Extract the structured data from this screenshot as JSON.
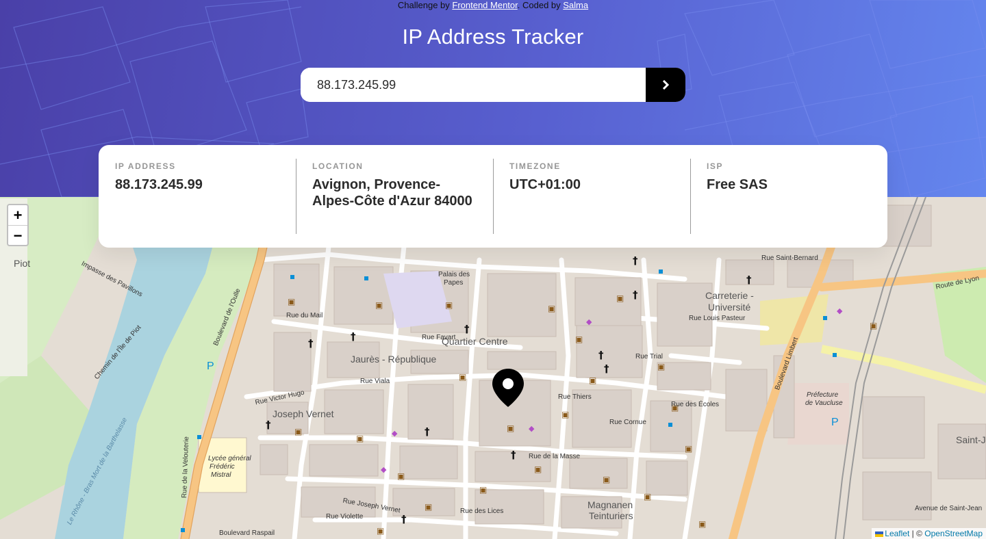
{
  "attribution": {
    "prefix": "Challenge by ",
    "mentor_link": "Frontend Mentor",
    "middle": ". Coded by ",
    "author_link": "Salma"
  },
  "header": {
    "title": "IP Address Tracker"
  },
  "search": {
    "value": "88.173.245.99",
    "submit_icon": "chevron-right-icon"
  },
  "info": {
    "ip_label": "IP ADDRESS",
    "ip_value": "88.173.245.99",
    "location_label": "LOCATION",
    "location_value": "Avignon, Provence-Alpes-Côte d'Azur 84000",
    "timezone_label": "TIMEZONE",
    "timezone_value": "UTC+01:00",
    "isp_label": "ISP",
    "isp_value": "Free SAS"
  },
  "map": {
    "zoom_in": "+",
    "zoom_out": "−",
    "credit_leaflet": "Leaflet",
    "credit_separator": " | © ",
    "credit_osm": "OpenStreetMap",
    "labels": {
      "quartier_centre": "Quartier Centre",
      "jaures": "Jaurès - République",
      "joseph_vernet": "Joseph Vernet",
      "carreterie": "Carreterie -",
      "universite": "Université",
      "magnanen": "Magnanen",
      "teinturiers": "Teinturiers",
      "piot": "Piot",
      "palais": "Palais des",
      "papes": "Papes",
      "lycee1": "Lycée général",
      "lycee2": "Frédéric",
      "lycee3": "Mistral",
      "prefecture1": "Préfecture",
      "prefecture2": "de Vaucluse",
      "saint_j": "Saint-J",
      "boulevard_oulle": "Boulevard de l'Oulle",
      "boulevard_limbert": "Boulevard Limbert",
      "rue_thiers": "Rue Thiers",
      "route_de_lyon": "Route de Lyon",
      "rue_des_lices": "Rue des Lices",
      "rue_joseph_vernet": "Rue Joseph Vernet",
      "rue_victor_hugo": "Rue Victor Hugo",
      "rue_du_mail": "Rue du Mail",
      "rue_louis_pasteur": "Rue Louis Pasteur",
      "rue_saint_bernard": "Rue Saint-Bernard",
      "boulevard_raspail": "Boulevard Raspail",
      "rue_violette": "Rue Violette",
      "rue_viala": "Rue Viala",
      "rue_de_la_masse": "Rue de la Masse",
      "rue_des_ecoles": "Rue des Écoles",
      "rue_cornue": "Rue Cornue",
      "rue_trial": "Rue Trial",
      "impasse_pavillons": "Impasse des Pavillons",
      "rue_favart": "Rue Favart",
      "avenue_saint_jean": "Avenue de Saint-Jean",
      "rue_de_la_velouterie": "Rue de la Velouterie",
      "chemin_ile_piot": "Chemin de l'Île de Piot",
      "rhone": "Le Rhône - Bras Mort de la Barthelasse"
    },
    "marker_icon": "location-pin-icon"
  },
  "colors": {
    "header_start": "#4a40a8",
    "header_end": "#6486ee",
    "river": "#aad3df",
    "road_main": "#f7c583",
    "building": "#d9d0c9",
    "park": "#cdebb0"
  }
}
